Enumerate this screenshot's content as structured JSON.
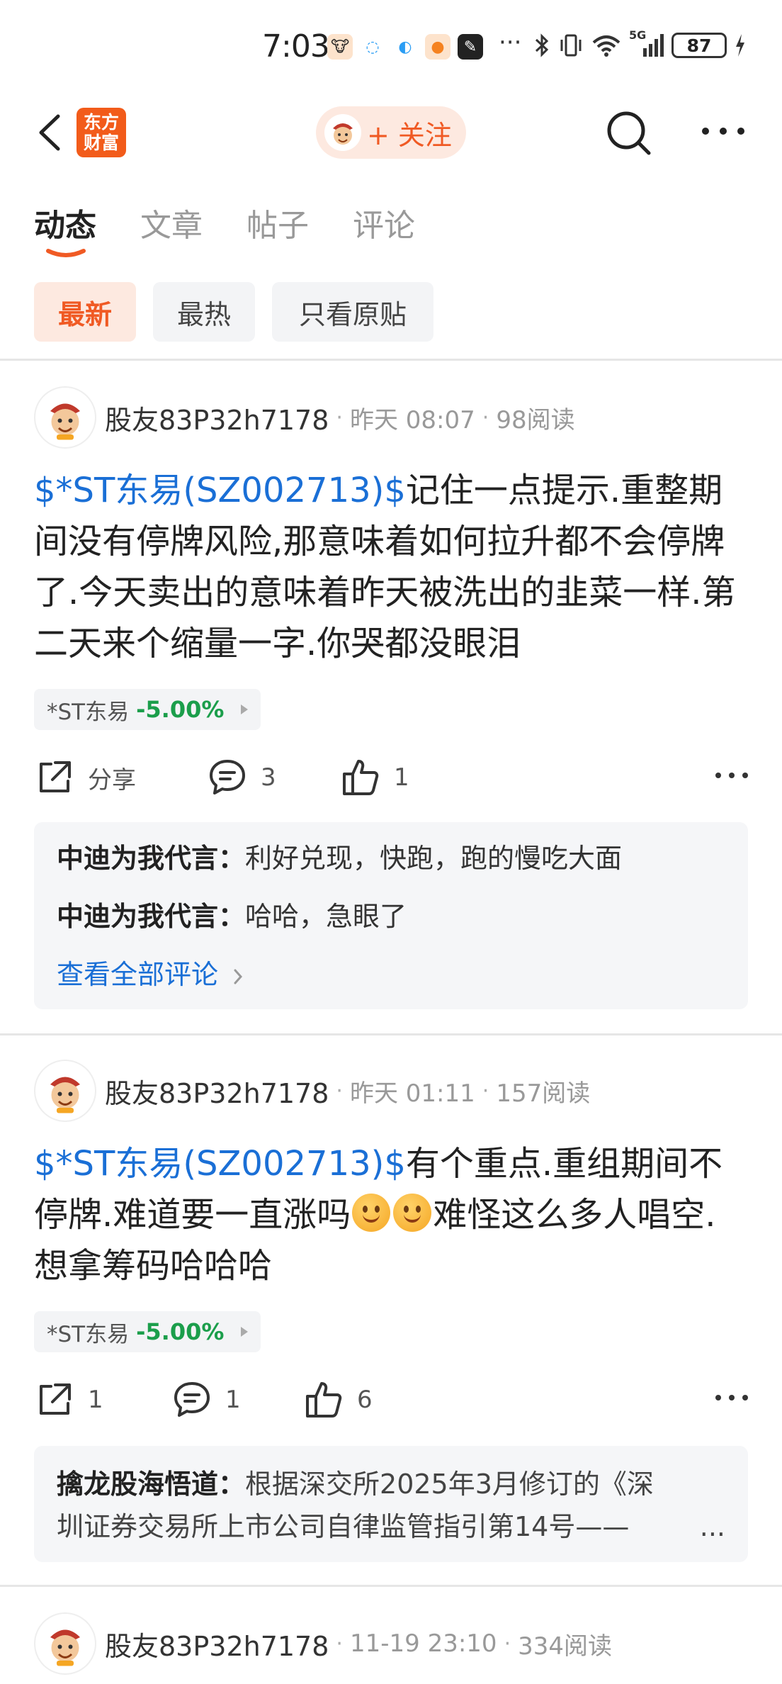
{
  "status_bar": {
    "time": "7:03",
    "more": "···",
    "network": "5G",
    "battery": "87"
  },
  "header": {
    "logo_text": "东方\n财富",
    "logo_line1": "东方",
    "logo_line2": "财富",
    "follow_label": "+ 关注"
  },
  "tabs": [
    {
      "label": "动态",
      "active": true
    },
    {
      "label": "文章",
      "active": false
    },
    {
      "label": "帖子",
      "active": false
    },
    {
      "label": "评论",
      "active": false
    }
  ],
  "filters": [
    {
      "label": "最新",
      "active": true
    },
    {
      "label": "最热",
      "active": false
    },
    {
      "label": "只看原贴",
      "active": false
    }
  ],
  "posts": [
    {
      "username": "股友83P32h7178",
      "time": "昨天 08:07",
      "reads": "98阅读",
      "stock_link": "$*ST东易(SZ002713)$",
      "text": "记住一点提示.重整期间没有停牌风险,那意味着如何拉升都不会停牌了.今天卖出的意味着昨天被洗出的韭菜一样.第二天来个缩量一字.你哭都没眼泪",
      "stock_tag": {
        "name": "*ST东易",
        "change": "-5.00%"
      },
      "share_label": "分享",
      "comment_count": "3",
      "like_count": "1",
      "comments": [
        {
          "author": "中迪为我代言",
          "text": "利好兑现，快跑，跑的慢吃大面"
        },
        {
          "author": "中迪为我代言",
          "text": "哈哈，急眼了"
        }
      ],
      "view_all": "查看全部评论"
    },
    {
      "username": "股友83P32h7178",
      "time": "昨天 01:11",
      "reads": "157阅读",
      "stock_link": "$*ST东易(SZ002713)$",
      "text_a": "有个重点.重组期间不停牌.难道要一直涨吗",
      "text_b": "难怪这么多人唱空.想拿筹码哈哈哈",
      "stock_tag": {
        "name": "*ST东易",
        "change": "-5.00%"
      },
      "share_count": "1",
      "comment_count": "1",
      "like_count": "6",
      "comment_preview": {
        "author": "擒龙股海悟道",
        "line1": "根据深交所2025年3月修订的《深",
        "line2": "圳证券交易所上市公司自律监管指引第14号——",
        "ellipsis": "..."
      }
    },
    {
      "username": "股友83P32h7178",
      "time": "11-19 23:10",
      "reads": "334阅读"
    }
  ],
  "colors": {
    "accent": "#f05a24",
    "link": "#1a6fd6",
    "stock_down": "#1b9e4b"
  },
  "icons": [
    "back-arrow-icon",
    "app-logo",
    "search-icon",
    "more-icon",
    "share-icon",
    "comment-icon",
    "like-icon",
    "smile-emoji-icon",
    "avatar-icon"
  ]
}
